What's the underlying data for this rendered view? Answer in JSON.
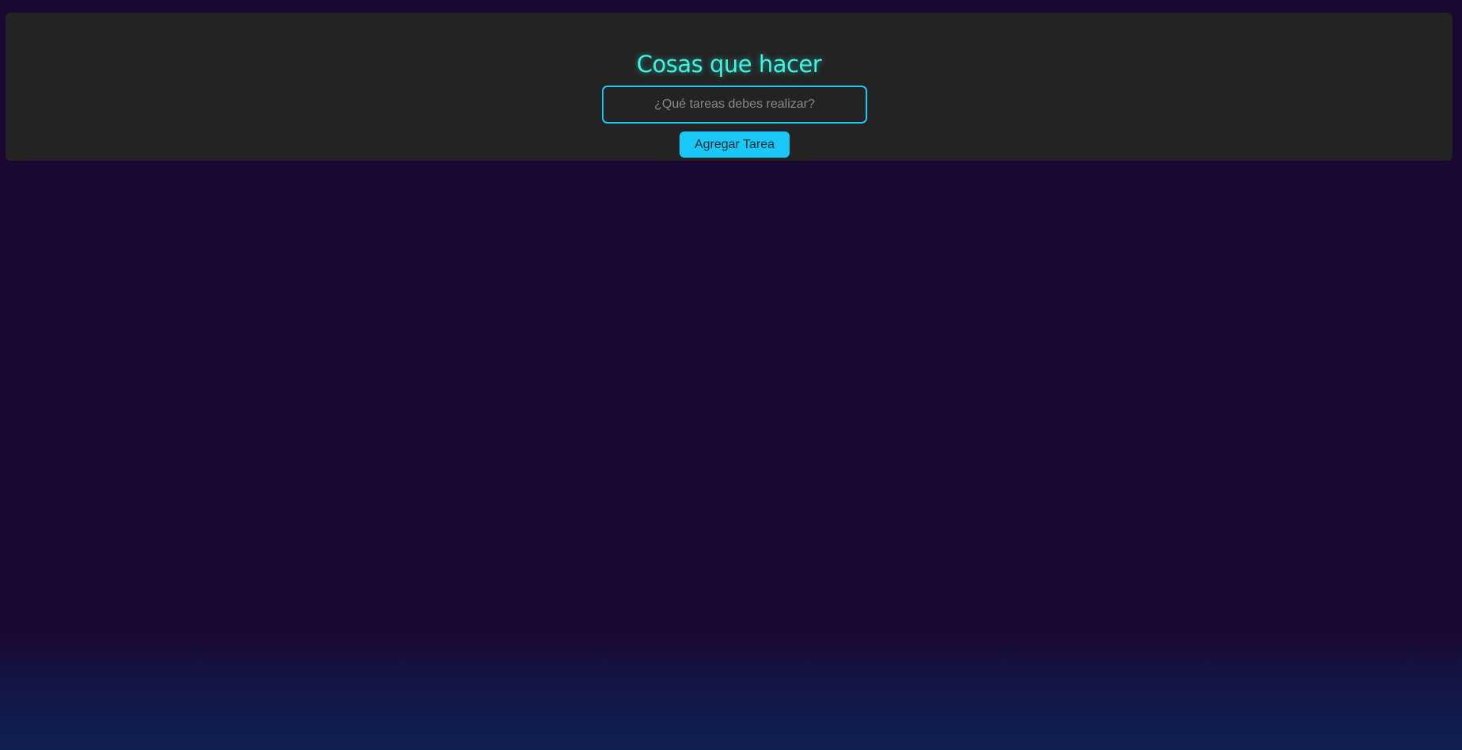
{
  "app": {
    "title": "Cosas que hacer"
  },
  "task_form": {
    "input_value": "",
    "input_placeholder": "¿Qué tareas debes realizar?",
    "add_button_label": "Agregar Tarea"
  },
  "colors": {
    "page_background": "#190831",
    "panel_background": "#232323",
    "title_color": "#3df5e0",
    "accent": "#19c8f5",
    "button_text": "#222a35"
  }
}
